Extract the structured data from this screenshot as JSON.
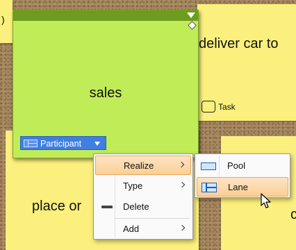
{
  "notes": {
    "deliver_car_text": "deliver car to",
    "place_order_text": "place or",
    "right_fragment_text": "c",
    "top_left_fragment": ")"
  },
  "participant": {
    "name": "sales",
    "tag_label": "Participant",
    "fill_color": "#c0ec58",
    "header_color": "#6d9c1f"
  },
  "task": {
    "label": "Task"
  },
  "context_menu": {
    "items": [
      {
        "label": "Realize",
        "has_submenu": true,
        "highlighted": true
      },
      {
        "label": "Type",
        "has_submenu": true,
        "highlighted": false
      },
      {
        "label": "Delete",
        "has_submenu": false,
        "highlighted": false,
        "icon": "delete-icon"
      },
      {
        "label": "Add",
        "has_submenu": true,
        "highlighted": false
      }
    ]
  },
  "submenu": {
    "items": [
      {
        "label": "Pool",
        "icon": "pool-icon",
        "highlighted": false
      },
      {
        "label": "Lane",
        "icon": "lane-icon",
        "highlighted": true
      }
    ]
  },
  "colors": {
    "note_yellow": "#fbf07d",
    "tag_blue": "#3f7fe1",
    "menu_highlight": "#fbcf95"
  }
}
